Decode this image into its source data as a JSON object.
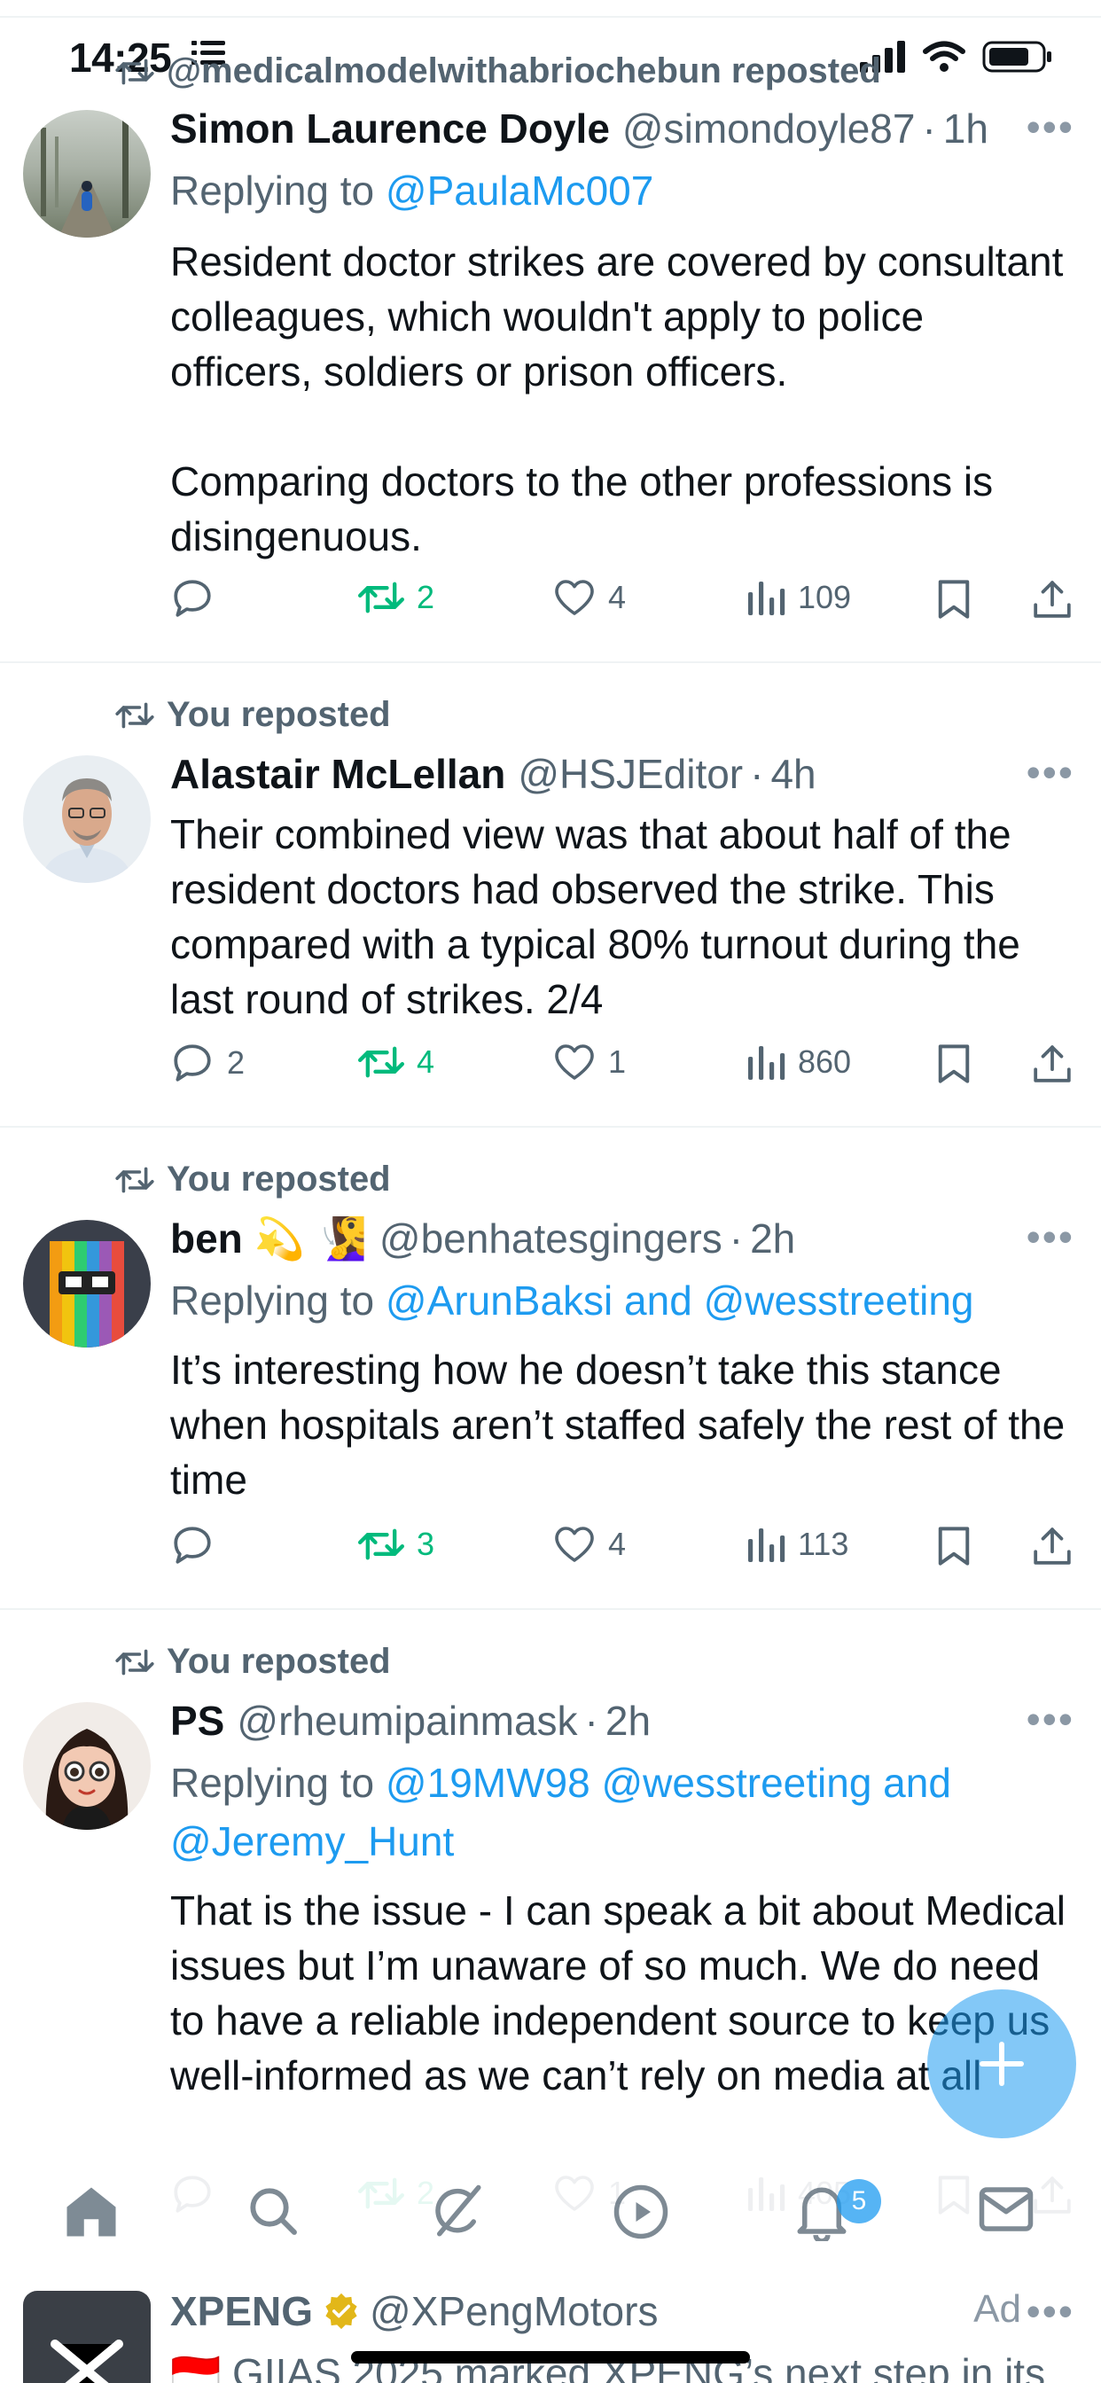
{
  "status": {
    "time": "14:25"
  },
  "tweets": [
    {
      "repost_label": "@medicalmodelwithabriochebun reposted",
      "name": "Simon Laurence Doyle",
      "handle": "@simondoyle87",
      "time": "1h",
      "reply_prefix": "Replying to ",
      "reply_targets": "@PaulaMc007",
      "text": "Resident doctor strikes are covered by consultant colleagues, which wouldn't apply to police officers, soldiers or prison officers.\n\nComparing doctors to the other professions is disingenuous.",
      "replies": "",
      "reposts": "2",
      "likes": "4",
      "views": "109"
    },
    {
      "repost_label": "You reposted",
      "name": "Alastair McLellan",
      "handle": "@HSJEditor",
      "time": "4h",
      "text": "Their combined view was that about half of the resident doctors had observed the strike. This compared with a typical 80% turnout during the last round of strikes. 2/4",
      "replies": "2",
      "reposts": "4",
      "likes": "1",
      "views": "860"
    },
    {
      "repost_label": "You reposted",
      "name": "ben 💫 🧏‍♀️",
      "handle": "@benhatesgingers",
      "time": "2h",
      "reply_prefix": "Replying to ",
      "reply_targets": "@ArunBaksi and @wesstreeting",
      "text": "It’s interesting how he doesn’t take this stance when hospitals aren’t staffed safely the rest of the time",
      "replies": "",
      "reposts": "3",
      "likes": "4",
      "views": "113"
    },
    {
      "repost_label": "You reposted",
      "name": "PS",
      "handle": "@rheumipainmask",
      "time": "2h",
      "reply_prefix": "Replying to ",
      "reply_targets": "@19MW98 @wesstreeting and @Jeremy_Hunt",
      "text": "That is the issue - I can speak a bit about Medical issues but I’m unaware of so much. We do need to have a reliable independent source to keep us well-informed as we can’t rely on media at all",
      "replies": "",
      "reposts": "2",
      "likes": "1",
      "views": "405"
    }
  ],
  "nav": {
    "notifications_badge": "5"
  },
  "ad": {
    "name": "XPENG",
    "handle": "@XPengMotors",
    "label": "Ad",
    "text": "🇮🇩 GIIAS 2025 marked XPENG’s next step in its"
  },
  "colors": {
    "accent": "#1d9bf0",
    "repost_green": "#00ba7c",
    "muted": "#536471"
  }
}
